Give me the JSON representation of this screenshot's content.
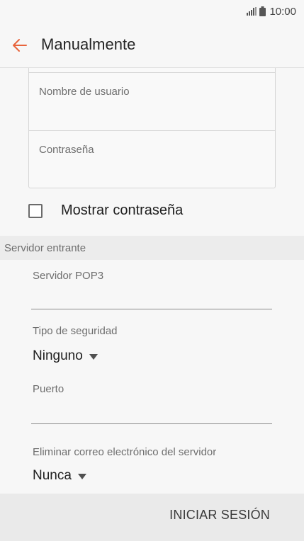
{
  "status_bar": {
    "time": "10:00",
    "icons": [
      "signal-icon",
      "battery-icon"
    ]
  },
  "app_bar": {
    "back_icon": "arrow-left-icon",
    "title": "Manualmente",
    "accent_color": "#e8643c"
  },
  "account_card": {
    "fields": [
      {
        "label": "Nombre de usuario",
        "value": ""
      },
      {
        "label": "Contraseña",
        "value": ""
      }
    ]
  },
  "show_password": {
    "label": "Mostrar contraseña",
    "checked": false
  },
  "incoming_server": {
    "section_title": "Servidor entrante",
    "pop3_server": {
      "label": "Servidor POP3",
      "value": ""
    },
    "security_type": {
      "label": "Tipo de seguridad",
      "selected": "Ninguno"
    },
    "port": {
      "label": "Puerto",
      "value": ""
    },
    "delete_email": {
      "label": "Eliminar correo electrónico del servidor",
      "selected": "Nunca"
    }
  },
  "footer": {
    "login_label": "INICIAR SESIÓN"
  }
}
